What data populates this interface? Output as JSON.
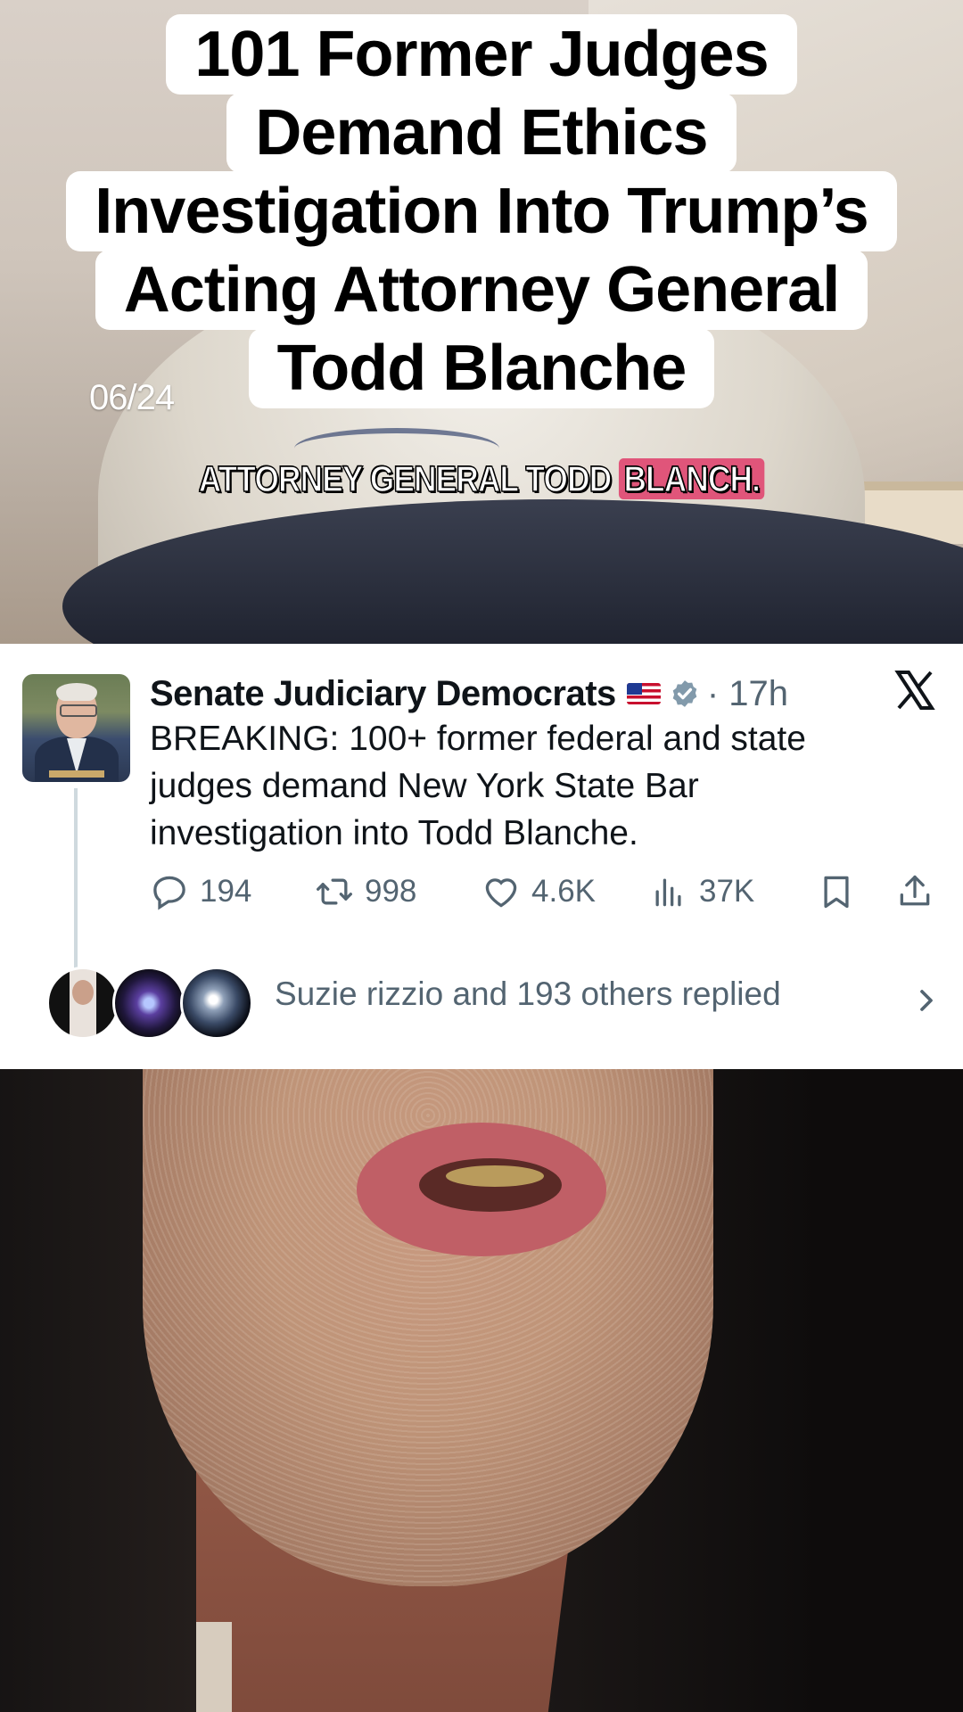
{
  "video": {
    "title_lines": [
      "101 Former Judges",
      "Demand Ethics",
      "Investigation Into Trump’s",
      "Acting Attorney General",
      "Todd Blanche"
    ],
    "date_stamp": "06/24",
    "caption_main": "ATTORNEY GENERAL TODD",
    "caption_highlight": "BLANCH."
  },
  "tweet": {
    "author": "Senate Judiciary Democrats",
    "time": "17h",
    "text": "BREAKING: 100+ former federal and state judges demand New York State Bar investigation into Todd Blanche.",
    "replies": "194",
    "retweets": "998",
    "likes": "4.6K",
    "views": "37K",
    "replied_summary": "Suzie rizzio and 193 others replied"
  },
  "icons": {
    "reply": "reply-icon",
    "retweet": "retweet-icon",
    "like": "heart-icon",
    "views": "views-icon",
    "bookmark": "bookmark-icon",
    "share": "share-icon",
    "platform": "x-logo-icon",
    "verified": "verified-badge-icon"
  },
  "colors": {
    "caption_highlight": "#e0557a",
    "verified": "#829aab",
    "meta_text": "#536471"
  }
}
